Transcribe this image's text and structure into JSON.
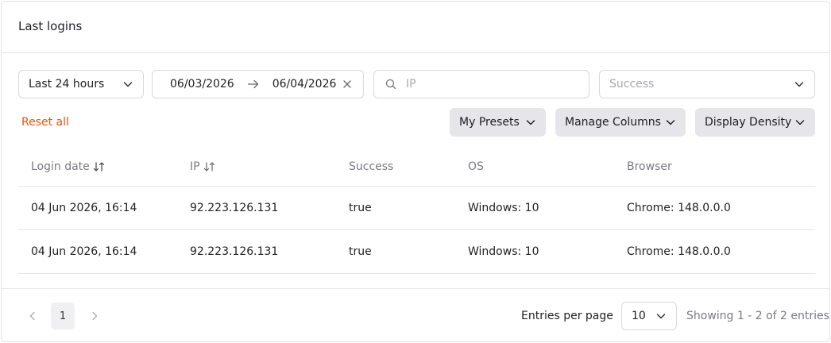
{
  "card": {
    "title": "Last logins"
  },
  "filters": {
    "period": {
      "value": "Last 24 hours"
    },
    "date_range": {
      "from": "06/03/2026",
      "to": "06/04/2026"
    },
    "ip": {
      "placeholder": "IP"
    },
    "success": {
      "placeholder": "Success"
    }
  },
  "toolbar": {
    "reset_label": "Reset all",
    "presets_label": "My Presets",
    "columns_label": "Manage Columns",
    "density_label": "Display Density"
  },
  "table": {
    "headers": [
      "Login date",
      "IP",
      "Success",
      "OS",
      "Browser"
    ],
    "rows": [
      [
        "04 Jun 2026, 16:14",
        "92.223.126.131",
        "true",
        "Windows: 10",
        "Chrome: 148.0.0.0"
      ],
      [
        "04 Jun 2026, 16:14",
        "92.223.126.131",
        "true",
        "Windows: 10",
        "Chrome: 148.0.0.0"
      ]
    ]
  },
  "pagination": {
    "current_page": "1",
    "entries_label": "Entries per page",
    "entries_value": "10",
    "showing": "Showing 1 - 2 of 2 entries"
  },
  "colors": {
    "accent": "#e8540f",
    "pill_bg": "#e6e5ea",
    "border": "#d9d9de",
    "muted": "#7a7a82"
  },
  "icons": [
    "chevron-down-icon",
    "arrow-right-icon",
    "close-icon",
    "search-icon",
    "sort-icon",
    "chevron-left-icon",
    "chevron-right-icon"
  ]
}
